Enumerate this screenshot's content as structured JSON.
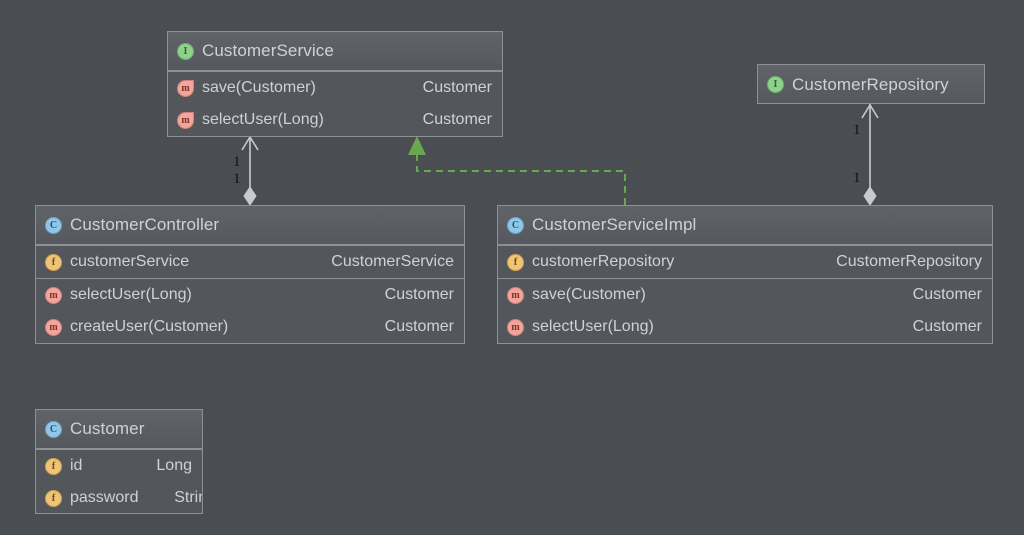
{
  "diagram": {
    "kind": "uml-class-diagram",
    "background_color": "#4a4e52",
    "box_border_color": "#8d9196",
    "header_color": "#5a5e63",
    "body_color": "#53575b",
    "text_color": "#cfd2d4",
    "connector_color": "#c8cbcd",
    "realization_color": "#6aa84f",
    "multiplicity_text_color": "#0f1112"
  },
  "classes": [
    {
      "id": "customer-service",
      "name": "CustomerService",
      "stereotype": "interface",
      "icon": "interface-icon",
      "sections": [
        {
          "kind": "methods",
          "rows": [
            {
              "icon": "abstract-method-icon",
              "kind": "method",
              "name": "save(Customer)",
              "type": "Customer"
            },
            {
              "icon": "abstract-method-icon",
              "kind": "method",
              "name": "selectUser(Long)",
              "type": "Customer"
            }
          ]
        }
      ]
    },
    {
      "id": "customer-repository",
      "name": "CustomerRepository",
      "stereotype": "interface",
      "icon": "interface-icon",
      "sections": []
    },
    {
      "id": "customer-controller",
      "name": "CustomerController",
      "stereotype": "class",
      "icon": "class-icon",
      "sections": [
        {
          "kind": "fields",
          "rows": [
            {
              "icon": "field-icon",
              "kind": "field",
              "name": "customerService",
              "type": "CustomerService"
            }
          ]
        },
        {
          "kind": "methods",
          "rows": [
            {
              "icon": "method-icon",
              "kind": "method",
              "name": "selectUser(Long)",
              "type": "Customer"
            },
            {
              "icon": "method-icon",
              "kind": "method",
              "name": "createUser(Customer)",
              "type": "Customer"
            }
          ]
        }
      ]
    },
    {
      "id": "customer-service-impl",
      "name": "CustomerServiceImpl",
      "stereotype": "class",
      "icon": "class-icon",
      "sections": [
        {
          "kind": "fields",
          "rows": [
            {
              "icon": "field-icon",
              "kind": "field",
              "name": "customerRepository",
              "type": "CustomerRepository"
            }
          ]
        },
        {
          "kind": "methods",
          "rows": [
            {
              "icon": "method-icon",
              "kind": "method",
              "name": "save(Customer)",
              "type": "Customer"
            },
            {
              "icon": "method-icon",
              "kind": "method",
              "name": "selectUser(Long)",
              "type": "Customer"
            }
          ]
        }
      ]
    },
    {
      "id": "customer",
      "name": "Customer",
      "stereotype": "class",
      "icon": "class-icon",
      "sections": [
        {
          "kind": "fields",
          "rows": [
            {
              "icon": "field-icon",
              "kind": "field",
              "name": "id",
              "type": "Long"
            },
            {
              "icon": "field-icon",
              "kind": "field",
              "name": "password",
              "type": "String",
              "clipped": true
            }
          ]
        }
      ]
    }
  ],
  "relations": [
    {
      "id": "controller-to-service-a",
      "type": "aggregation",
      "from": "CustomerController",
      "to": "CustomerService",
      "multiplicity_source": "1",
      "multiplicity_target": "1"
    },
    {
      "id": "impl-to-service",
      "type": "realization",
      "from": "CustomerServiceImpl",
      "to": "CustomerService",
      "multiplicity_source": "",
      "multiplicity_target": ""
    },
    {
      "id": "impl-to-repository",
      "type": "aggregation",
      "from": "CustomerServiceImpl",
      "to": "CustomerRepository",
      "multiplicity_source": "1",
      "multiplicity_target": "1"
    }
  ],
  "multiplicity_labels": [
    {
      "id": "label-left-top",
      "text": "1"
    },
    {
      "id": "label-left-bottom",
      "text": "1"
    },
    {
      "id": "label-right-top",
      "text": "1"
    },
    {
      "id": "label-right-bottom",
      "text": "1"
    }
  ]
}
